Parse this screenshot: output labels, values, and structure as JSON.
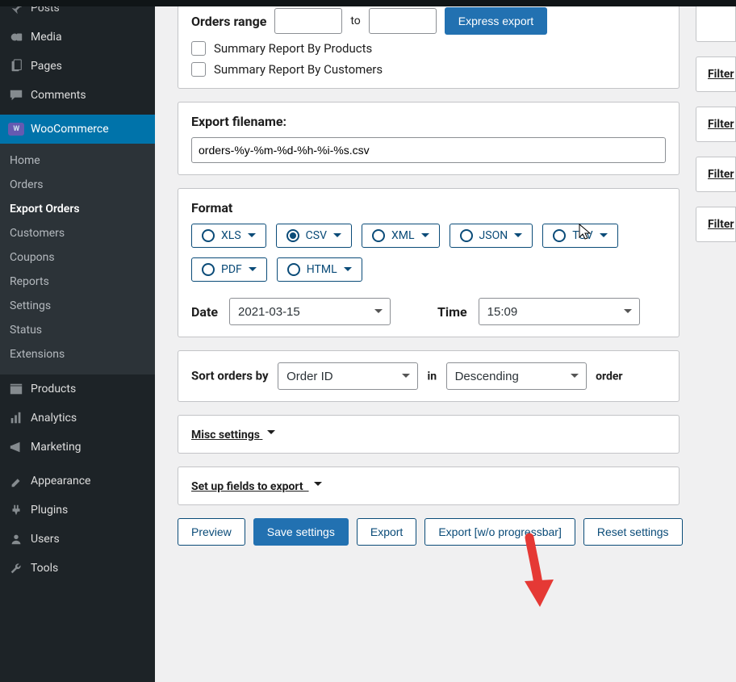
{
  "sidebar": {
    "items_top": [
      {
        "label": "Posts",
        "icon": "pin"
      },
      {
        "label": "Media",
        "icon": "media"
      },
      {
        "label": "Pages",
        "icon": "page"
      },
      {
        "label": "Comments",
        "icon": "comment"
      }
    ],
    "woo_label": "WooCommerce",
    "woo_badge": "Woo",
    "woo_sub": [
      {
        "label": "Home"
      },
      {
        "label": "Orders"
      },
      {
        "label": "Export Orders",
        "current": true
      },
      {
        "label": "Customers"
      },
      {
        "label": "Coupons"
      },
      {
        "label": "Reports"
      },
      {
        "label": "Settings"
      },
      {
        "label": "Status"
      },
      {
        "label": "Extensions"
      }
    ],
    "items_bottom": [
      {
        "label": "Products",
        "icon": "products"
      },
      {
        "label": "Analytics",
        "icon": "analytics"
      },
      {
        "label": "Marketing",
        "icon": "marketing"
      },
      {
        "label": "Appearance",
        "icon": "appearance"
      },
      {
        "label": "Plugins",
        "icon": "plugins"
      },
      {
        "label": "Users",
        "icon": "users"
      },
      {
        "label": "Tools",
        "icon": "tools"
      }
    ]
  },
  "orders_range": {
    "label": "Orders range",
    "sep": "to",
    "express_btn": "Express export",
    "summary_products": "Summary Report By Products",
    "summary_customers": "Summary Report By Customers"
  },
  "filename": {
    "label": "Export filename:",
    "value": "orders-%y-%m-%d-%h-%i-%s.csv"
  },
  "format": {
    "label": "Format",
    "opts": [
      "XLS",
      "CSV",
      "XML",
      "JSON",
      "TSV",
      "PDF",
      "HTML"
    ],
    "selected": "CSV",
    "date_label": "Date",
    "date_value": "2021-03-15",
    "time_label": "Time",
    "time_value": "15:09"
  },
  "sort": {
    "label": "Sort orders by",
    "field": "Order ID",
    "in": "in",
    "dir": "Descending",
    "trail": "order"
  },
  "misc": "Misc settings",
  "setup": "Set up fields to export ",
  "actions": {
    "preview": "Preview",
    "save": "Save settings",
    "export": "Export",
    "export_wo": "Export [w/o progressbar]",
    "reset": "Reset settings"
  },
  "filter_peek": "Filter"
}
